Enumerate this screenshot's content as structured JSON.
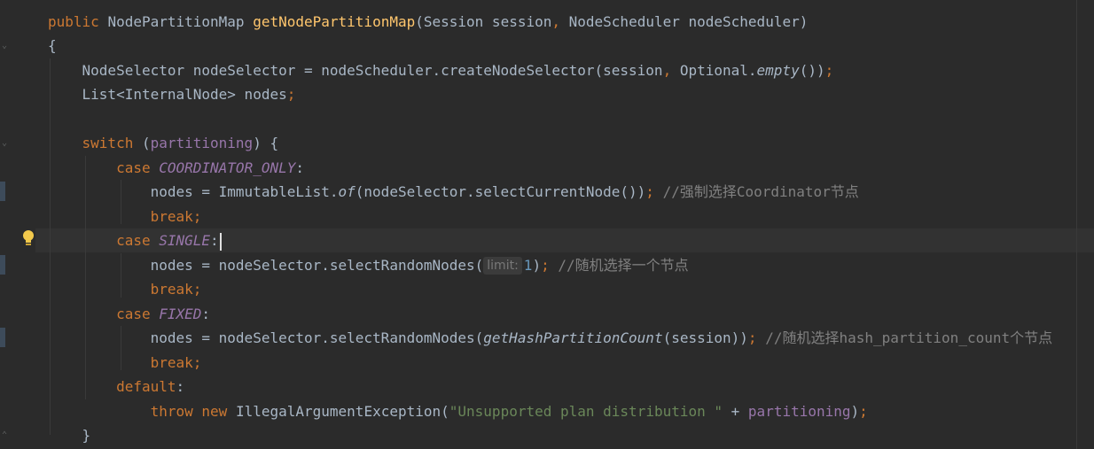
{
  "code": {
    "signature": {
      "modifier": "public",
      "return_type": "NodePartitionMap",
      "method_name": "getNodePartitionMap",
      "params_1": "(Session session",
      "comma": ",",
      "params_2": " NodeScheduler nodeScheduler)"
    },
    "open_brace": "{",
    "l3": {
      "a": "NodeSelector nodeSelector = nodeScheduler.createNodeSelector(session",
      "comma": ",",
      "b": " Optional.",
      "m": "empty",
      "c": "())",
      "semi": ";"
    },
    "l4": {
      "a": "List<InternalNode> nodes",
      "semi": ";"
    },
    "l6": {
      "kw": "switch",
      "paren_open": " (",
      "var": "partitioning",
      "rest": ") {"
    },
    "l7": {
      "kw": "case",
      "const": "COORDINATOR_ONLY",
      "colon": ":"
    },
    "l8": {
      "a": "nodes = ImmutableList.",
      "m": "of",
      "b": "(nodeSelector.selectCurrentNode())",
      "semi": ";",
      "comment": "//强制选择Coordinator节点"
    },
    "l9": {
      "kw": "break",
      "semi": ";"
    },
    "l10": {
      "kw": "case",
      "const": "SINGLE",
      "colon": ":"
    },
    "l11": {
      "a": "nodes = nodeSelector.selectRandomNodes(",
      "hint": "limit:",
      "num": "1",
      "b": ")",
      "semi": ";",
      "comment": "//随机选择一个节点"
    },
    "l12": {
      "kw": "break",
      "semi": ";"
    },
    "l13": {
      "kw": "case",
      "const": "FIXED",
      "colon": ":"
    },
    "l14": {
      "a": "nodes = nodeSelector.selectRandomNodes(",
      "m": "getHashPartitionCount",
      "b": "(session))",
      "semi": ";",
      "comment": "//随机选择hash_partition_count个节点"
    },
    "l15": {
      "kw": "break",
      "semi": ";"
    },
    "l16": {
      "kw": "default",
      "colon": ":"
    },
    "l17": {
      "kw1": "throw",
      "kw2": "new",
      "a": " IllegalArgumentException(",
      "str": "\"Unsupported plan distribution \"",
      "b": " + ",
      "var": "partitioning",
      "c": ")",
      "semi": ";"
    },
    "l18": {
      "a": "}"
    }
  },
  "gutter": {
    "bulb_icon": "lightbulb-icon",
    "fold_icon": "fold-icon"
  },
  "colors": {
    "background": "#2b2b2b",
    "keyword": "#cc7832",
    "method": "#ffc66d",
    "constant": "#9876aa",
    "string": "#6a8759",
    "comment": "#808080",
    "number": "#6897bb",
    "text": "#a9b7c6"
  }
}
